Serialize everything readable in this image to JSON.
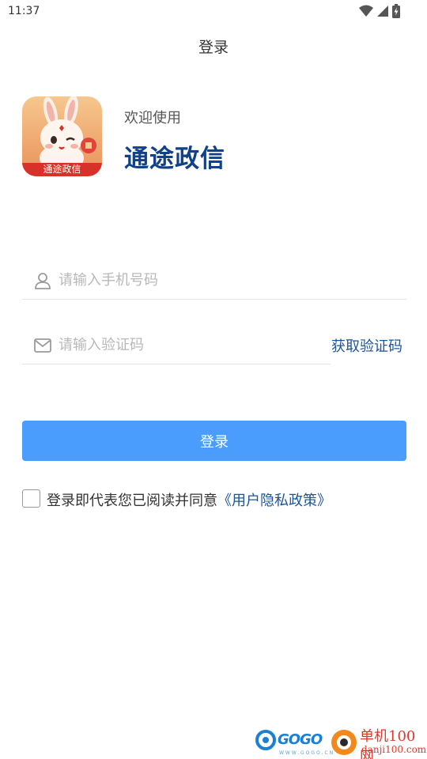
{
  "status_bar": {
    "time": "11:37"
  },
  "header": {
    "title": "登录"
  },
  "app": {
    "welcome": "欢迎使用",
    "name": "通途政信",
    "logo_label": "通途政信",
    "logo_icon": "rabbit-mascot-icon"
  },
  "form": {
    "phone_placeholder": "请输入手机号码",
    "code_placeholder": "请输入验证码",
    "get_code_label": "获取验证码",
    "login_label": "登录"
  },
  "agreement": {
    "text": "登录即代表您已阅读并同意",
    "link": "《用户隐私政策》",
    "checked": false
  },
  "watermark": {
    "gogo": "GOGO",
    "gogo_sub": "WWW.GOGO.CN",
    "site": "单机100网",
    "domain": "danji100.com"
  },
  "colors": {
    "primary_button": "#4a9dfd",
    "link": "#1c5497",
    "app_name": "#114186"
  }
}
